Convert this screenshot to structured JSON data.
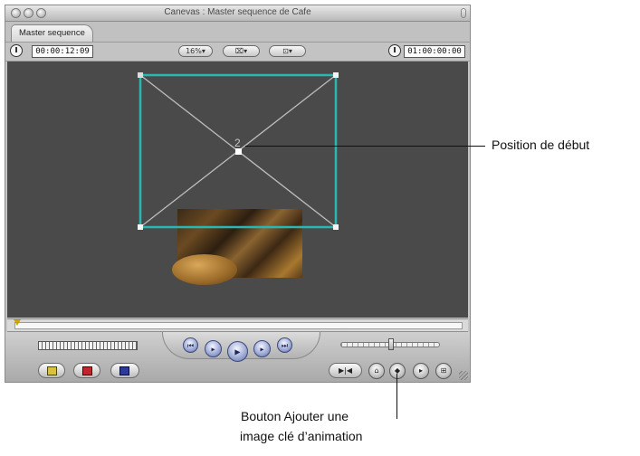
{
  "window": {
    "title": "Canevas : Master sequence de Cafe",
    "tab_label": "Master sequence"
  },
  "toolbar": {
    "current_timecode": "00:00:12:09",
    "zoom": "16%",
    "zoom_menu_icon": "zoom-dropdown-arrow",
    "view_menu_icon": "view-dropdown-icon",
    "overlay_menu_icon": "overlay-dropdown-icon",
    "duration_timecode": "01:00:00:00"
  },
  "canvas": {
    "motion_path_point_label": "2",
    "overlay_color": "#2ab7b4"
  },
  "transport": {
    "buttons": [
      "previous-edit",
      "play-in-to-out",
      "play",
      "play-around",
      "next-edit"
    ]
  },
  "bottom_bar": {
    "buttons": [
      "mark-in",
      "mark-out",
      "match-frame",
      "add-marker",
      "add-keyframe",
      "next-keyframe",
      "insert"
    ]
  },
  "callouts": {
    "start_position": "Position de début",
    "add_keyframe_line1": "Bouton Ajouter une",
    "add_keyframe_line2": "image clé d’animation"
  }
}
